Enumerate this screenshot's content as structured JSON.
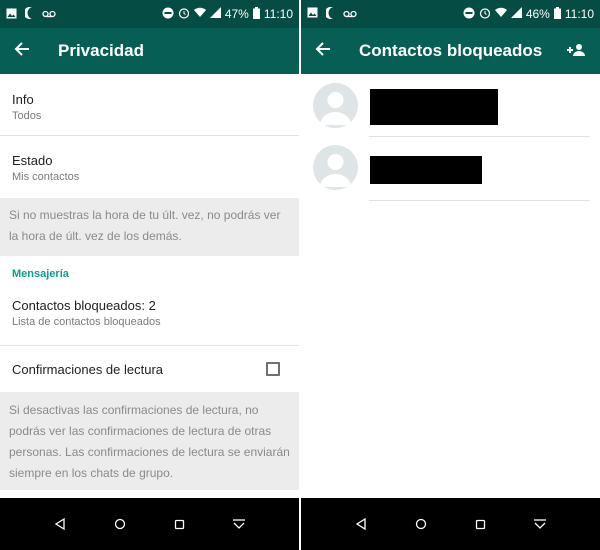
{
  "left": {
    "statusbar": {
      "battery": "47%",
      "time": "11:10"
    },
    "appbar": {
      "title": "Privacidad"
    },
    "rows": {
      "info": {
        "title": "Info",
        "subtitle": "Todos"
      },
      "estado": {
        "title": "Estado",
        "subtitle": "Mis contactos"
      }
    },
    "last_seen_note": "Si no muestras la hora de tu últ. vez, no podrás ver la hora de últ. vez de los demás.",
    "section_mensajeria": "Mensajería",
    "blocked_row": {
      "title": "Contactos bloqueados: 2",
      "subtitle": "Lista de contactos bloqueados"
    },
    "read_receipts": {
      "label": "Confirmaciones de lectura",
      "checked": false
    },
    "read_receipts_note": "Si desactivas las confirmaciones de lectura, no podrás ver las confirmaciones de lectura de otras personas. Las confirmaciones de lectura se enviarán siempre en los chats de grupo."
  },
  "right": {
    "statusbar": {
      "battery": "46%",
      "time": "11:10"
    },
    "appbar": {
      "title": "Contactos bloqueados"
    },
    "contacts_count": 2
  },
  "colors": {
    "statusbar": "#054d44",
    "appbar": "#075e54",
    "accent": "#0f9d8a",
    "navbar": "#000000"
  },
  "icons": [
    "gallery-icon",
    "moon-icon",
    "voicemail-icon",
    "do-not-disturb-icon",
    "alarm-icon",
    "wifi-icon",
    "signal-icon",
    "battery-icon",
    "back-arrow-icon",
    "add-contact-icon",
    "nav-back-icon",
    "nav-home-icon",
    "nav-recents-icon",
    "nav-menu-icon"
  ]
}
